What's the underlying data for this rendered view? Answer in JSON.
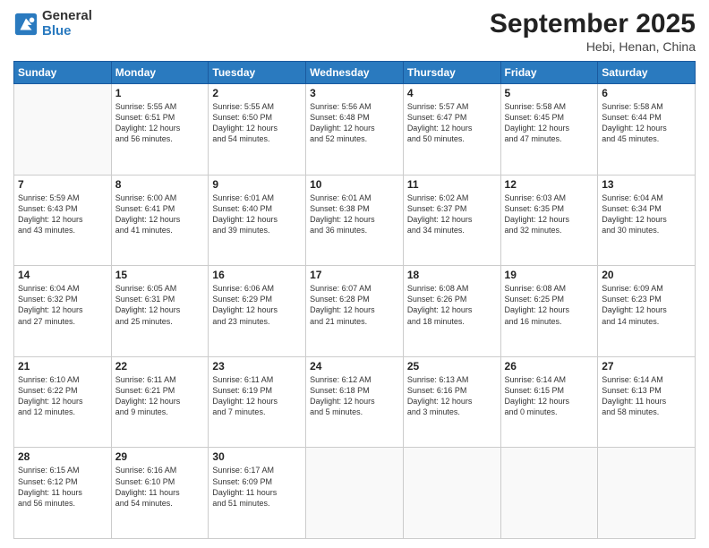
{
  "header": {
    "logo_general": "General",
    "logo_blue": "Blue",
    "month_title": "September 2025",
    "location": "Hebi, Henan, China"
  },
  "days_of_week": [
    "Sunday",
    "Monday",
    "Tuesday",
    "Wednesday",
    "Thursday",
    "Friday",
    "Saturday"
  ],
  "weeks": [
    [
      {
        "day": "",
        "info": ""
      },
      {
        "day": "1",
        "info": "Sunrise: 5:55 AM\nSunset: 6:51 PM\nDaylight: 12 hours\nand 56 minutes."
      },
      {
        "day": "2",
        "info": "Sunrise: 5:55 AM\nSunset: 6:50 PM\nDaylight: 12 hours\nand 54 minutes."
      },
      {
        "day": "3",
        "info": "Sunrise: 5:56 AM\nSunset: 6:48 PM\nDaylight: 12 hours\nand 52 minutes."
      },
      {
        "day": "4",
        "info": "Sunrise: 5:57 AM\nSunset: 6:47 PM\nDaylight: 12 hours\nand 50 minutes."
      },
      {
        "day": "5",
        "info": "Sunrise: 5:58 AM\nSunset: 6:45 PM\nDaylight: 12 hours\nand 47 minutes."
      },
      {
        "day": "6",
        "info": "Sunrise: 5:58 AM\nSunset: 6:44 PM\nDaylight: 12 hours\nand 45 minutes."
      }
    ],
    [
      {
        "day": "7",
        "info": "Sunrise: 5:59 AM\nSunset: 6:43 PM\nDaylight: 12 hours\nand 43 minutes."
      },
      {
        "day": "8",
        "info": "Sunrise: 6:00 AM\nSunset: 6:41 PM\nDaylight: 12 hours\nand 41 minutes."
      },
      {
        "day": "9",
        "info": "Sunrise: 6:01 AM\nSunset: 6:40 PM\nDaylight: 12 hours\nand 39 minutes."
      },
      {
        "day": "10",
        "info": "Sunrise: 6:01 AM\nSunset: 6:38 PM\nDaylight: 12 hours\nand 36 minutes."
      },
      {
        "day": "11",
        "info": "Sunrise: 6:02 AM\nSunset: 6:37 PM\nDaylight: 12 hours\nand 34 minutes."
      },
      {
        "day": "12",
        "info": "Sunrise: 6:03 AM\nSunset: 6:35 PM\nDaylight: 12 hours\nand 32 minutes."
      },
      {
        "day": "13",
        "info": "Sunrise: 6:04 AM\nSunset: 6:34 PM\nDaylight: 12 hours\nand 30 minutes."
      }
    ],
    [
      {
        "day": "14",
        "info": "Sunrise: 6:04 AM\nSunset: 6:32 PM\nDaylight: 12 hours\nand 27 minutes."
      },
      {
        "day": "15",
        "info": "Sunrise: 6:05 AM\nSunset: 6:31 PM\nDaylight: 12 hours\nand 25 minutes."
      },
      {
        "day": "16",
        "info": "Sunrise: 6:06 AM\nSunset: 6:29 PM\nDaylight: 12 hours\nand 23 minutes."
      },
      {
        "day": "17",
        "info": "Sunrise: 6:07 AM\nSunset: 6:28 PM\nDaylight: 12 hours\nand 21 minutes."
      },
      {
        "day": "18",
        "info": "Sunrise: 6:08 AM\nSunset: 6:26 PM\nDaylight: 12 hours\nand 18 minutes."
      },
      {
        "day": "19",
        "info": "Sunrise: 6:08 AM\nSunset: 6:25 PM\nDaylight: 12 hours\nand 16 minutes."
      },
      {
        "day": "20",
        "info": "Sunrise: 6:09 AM\nSunset: 6:23 PM\nDaylight: 12 hours\nand 14 minutes."
      }
    ],
    [
      {
        "day": "21",
        "info": "Sunrise: 6:10 AM\nSunset: 6:22 PM\nDaylight: 12 hours\nand 12 minutes."
      },
      {
        "day": "22",
        "info": "Sunrise: 6:11 AM\nSunset: 6:21 PM\nDaylight: 12 hours\nand 9 minutes."
      },
      {
        "day": "23",
        "info": "Sunrise: 6:11 AM\nSunset: 6:19 PM\nDaylight: 12 hours\nand 7 minutes."
      },
      {
        "day": "24",
        "info": "Sunrise: 6:12 AM\nSunset: 6:18 PM\nDaylight: 12 hours\nand 5 minutes."
      },
      {
        "day": "25",
        "info": "Sunrise: 6:13 AM\nSunset: 6:16 PM\nDaylight: 12 hours\nand 3 minutes."
      },
      {
        "day": "26",
        "info": "Sunrise: 6:14 AM\nSunset: 6:15 PM\nDaylight: 12 hours\nand 0 minutes."
      },
      {
        "day": "27",
        "info": "Sunrise: 6:14 AM\nSunset: 6:13 PM\nDaylight: 11 hours\nand 58 minutes."
      }
    ],
    [
      {
        "day": "28",
        "info": "Sunrise: 6:15 AM\nSunset: 6:12 PM\nDaylight: 11 hours\nand 56 minutes."
      },
      {
        "day": "29",
        "info": "Sunrise: 6:16 AM\nSunset: 6:10 PM\nDaylight: 11 hours\nand 54 minutes."
      },
      {
        "day": "30",
        "info": "Sunrise: 6:17 AM\nSunset: 6:09 PM\nDaylight: 11 hours\nand 51 minutes."
      },
      {
        "day": "",
        "info": ""
      },
      {
        "day": "",
        "info": ""
      },
      {
        "day": "",
        "info": ""
      },
      {
        "day": "",
        "info": ""
      }
    ]
  ]
}
